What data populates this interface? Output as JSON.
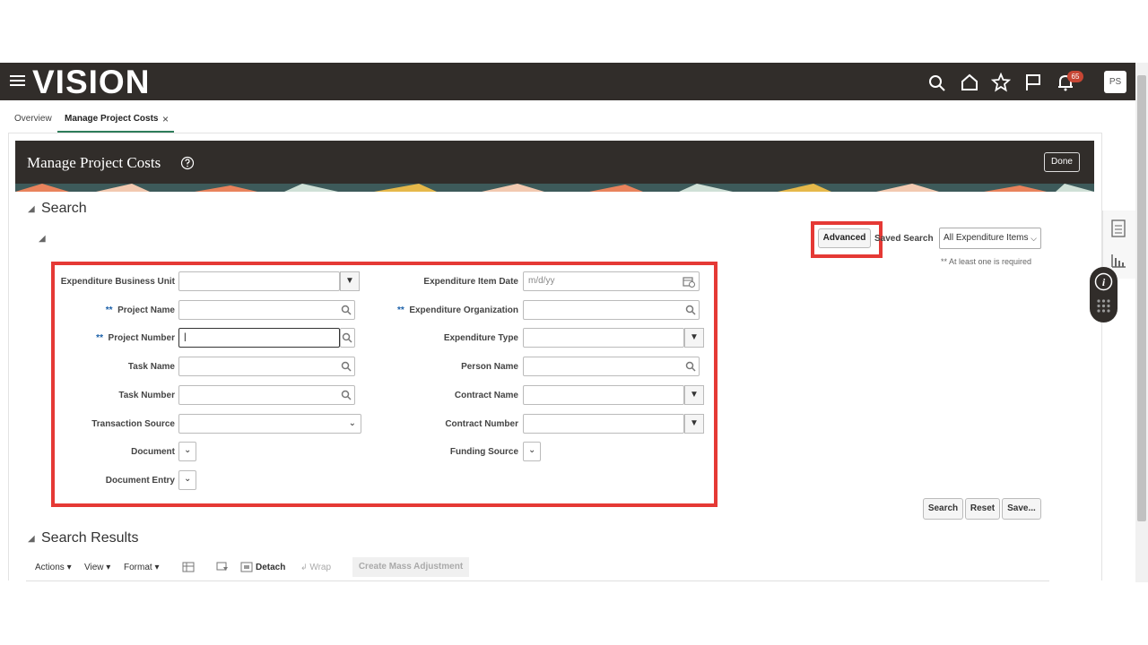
{
  "app": {
    "logo": "VISION",
    "notification_count": "65",
    "avatar_initials": "PS"
  },
  "icons": {
    "menu": "hamburger-icon",
    "search": "search-icon",
    "home": "home-icon",
    "favorites": "star-icon",
    "watchlist": "flag-icon",
    "notifications": "bell-icon",
    "help": "help-icon",
    "calendar": "calendar-icon",
    "info": "info-icon",
    "grid": "grid-icon",
    "report": "report-icon",
    "chart": "chart-icon"
  },
  "tabs": [
    {
      "label": "Overview"
    },
    {
      "label": "Manage Project Costs",
      "close": "×"
    }
  ],
  "page": {
    "title": "Manage Project Costs",
    "done_label": "Done"
  },
  "search": {
    "title": "Search",
    "advanced_label": "Advanced",
    "saved_search_label": "Saved Search",
    "saved_search_value": "All Expenditure Items",
    "required_note": "** At least one is required",
    "required_marker": "**",
    "fields": {
      "expenditure_business_unit": "Expenditure Business Unit",
      "project_name": "Project Name",
      "project_number": "Project Number",
      "task_name": "Task Name",
      "task_number": "Task Number",
      "transaction_source": "Transaction Source",
      "document": "Document",
      "document_entry": "Document Entry",
      "expenditure_item_date": "Expenditure Item Date",
      "expenditure_item_date_placeholder": "m/d/yy",
      "expenditure_organization": "Expenditure Organization",
      "expenditure_type": "Expenditure Type",
      "person_name": "Person Name",
      "contract_name": "Contract Name",
      "contract_number": "Contract Number",
      "funding_source": "Funding Source"
    },
    "buttons": {
      "search": "Search",
      "reset": "Reset",
      "save": "Save..."
    }
  },
  "results": {
    "title": "Search Results",
    "toolbar": {
      "actions": "Actions",
      "view": "View",
      "format": "Format",
      "detach": "Detach",
      "wrap": "Wrap",
      "create_mass_adjustment": "Create Mass Adjustment"
    }
  },
  "colors": {
    "header_bg": "#312d2a",
    "highlight": "#e53935",
    "accent_green": "#2e7d5a",
    "badge": "#c74634"
  }
}
